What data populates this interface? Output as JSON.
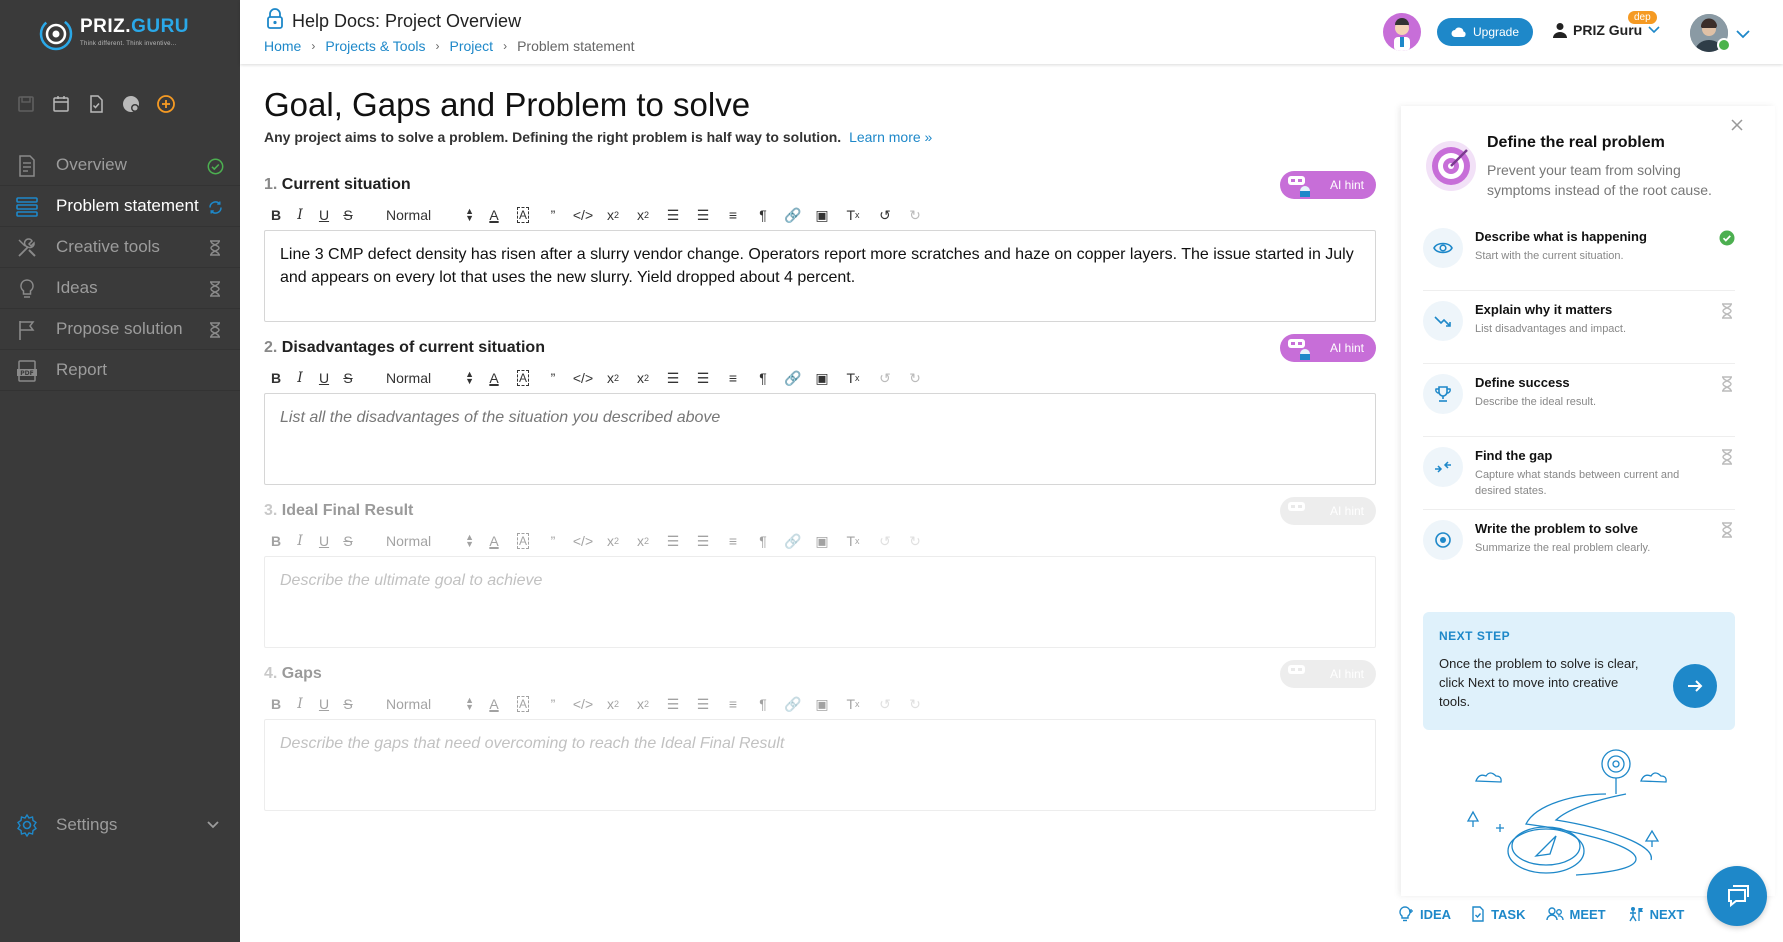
{
  "brand": {
    "logo_main": "PRIZ.",
    "logo_accent": "GURU",
    "tagline": "Think different. Think inventive..."
  },
  "sidebar": {
    "items": [
      {
        "label": "Overview",
        "icon": "document-icon",
        "status": "done"
      },
      {
        "label": "Problem statement",
        "icon": "layers-icon",
        "status": "in-progress"
      },
      {
        "label": "Creative tools",
        "icon": "tools-icon",
        "status": "pending"
      },
      {
        "label": "Ideas",
        "icon": "lightbulb-icon",
        "status": "pending"
      },
      {
        "label": "Propose solution",
        "icon": "flag-icon",
        "status": "pending"
      },
      {
        "label": "Report",
        "icon": "pdf-icon",
        "status": "none"
      }
    ],
    "settings_label": "Settings"
  },
  "header": {
    "title": "Help Docs: Project Overview",
    "breadcrumb": [
      "Home",
      "Projects & Tools",
      "Project",
      "Problem statement"
    ],
    "upgrade_label": "Upgrade",
    "user_name": "PRIZ Guru",
    "env_badge": "dep"
  },
  "main": {
    "title": "Goal, Gaps and Problem to solve",
    "subtitle": "Any project aims to solve a problem. Defining the right problem is half way to solution.",
    "learn_more": "Learn more »",
    "ai_hint_label": "AI hint",
    "format_select": "Normal",
    "sections": [
      {
        "num": "1.",
        "label": "Current situation",
        "enabled": true,
        "value": "Line 3 CMP defect density has risen after a slurry vendor change. Operators report more scratches and haze on copper layers. The issue started in July and appears on every lot that uses the new slurry. Yield dropped about 4 percent.",
        "placeholder": ""
      },
      {
        "num": "2.",
        "label": "Disadvantages of current situation",
        "enabled": true,
        "value": "",
        "placeholder": "List all the disadvantages of the situation you described above"
      },
      {
        "num": "3.",
        "label": "Ideal Final Result",
        "enabled": false,
        "value": "",
        "placeholder": "Describe the ultimate goal to achieve"
      },
      {
        "num": "4.",
        "label": "Gaps",
        "enabled": false,
        "value": "",
        "placeholder": "Describe the gaps that need overcoming to reach the Ideal Final Result"
      }
    ]
  },
  "panel": {
    "title": "Define the real problem",
    "description": "Prevent your team from solving symptoms instead of the root cause.",
    "steps": [
      {
        "title": "Describe what is happening",
        "desc": "Start with the current situation.",
        "icon": "eye-icon",
        "status": "done"
      },
      {
        "title": "Explain why it matters",
        "desc": "List disadvantages and impact.",
        "icon": "trend-down-icon",
        "status": "pending"
      },
      {
        "title": "Define success",
        "desc": "Describe the ideal result.",
        "icon": "trophy-icon",
        "status": "pending"
      },
      {
        "title": "Find the gap",
        "desc": "Capture what stands between current and desired states.",
        "icon": "arrows-in-icon",
        "status": "pending"
      },
      {
        "title": "Write the problem to solve",
        "desc": "Summarize the real problem clearly.",
        "icon": "target-icon",
        "status": "pending"
      }
    ],
    "next": {
      "label": "NEXT STEP",
      "text": "Once the problem to solve is clear, click Next to move into creative tools."
    }
  },
  "footer": {
    "idea": "IDEA",
    "task": "TASK",
    "meet": "MEET",
    "next": "NEXT"
  },
  "colors": {
    "accent": "#1e88c9",
    "ai": "#c76ed8",
    "success": "#4caf50",
    "sidebar": "#3a3a3a"
  }
}
